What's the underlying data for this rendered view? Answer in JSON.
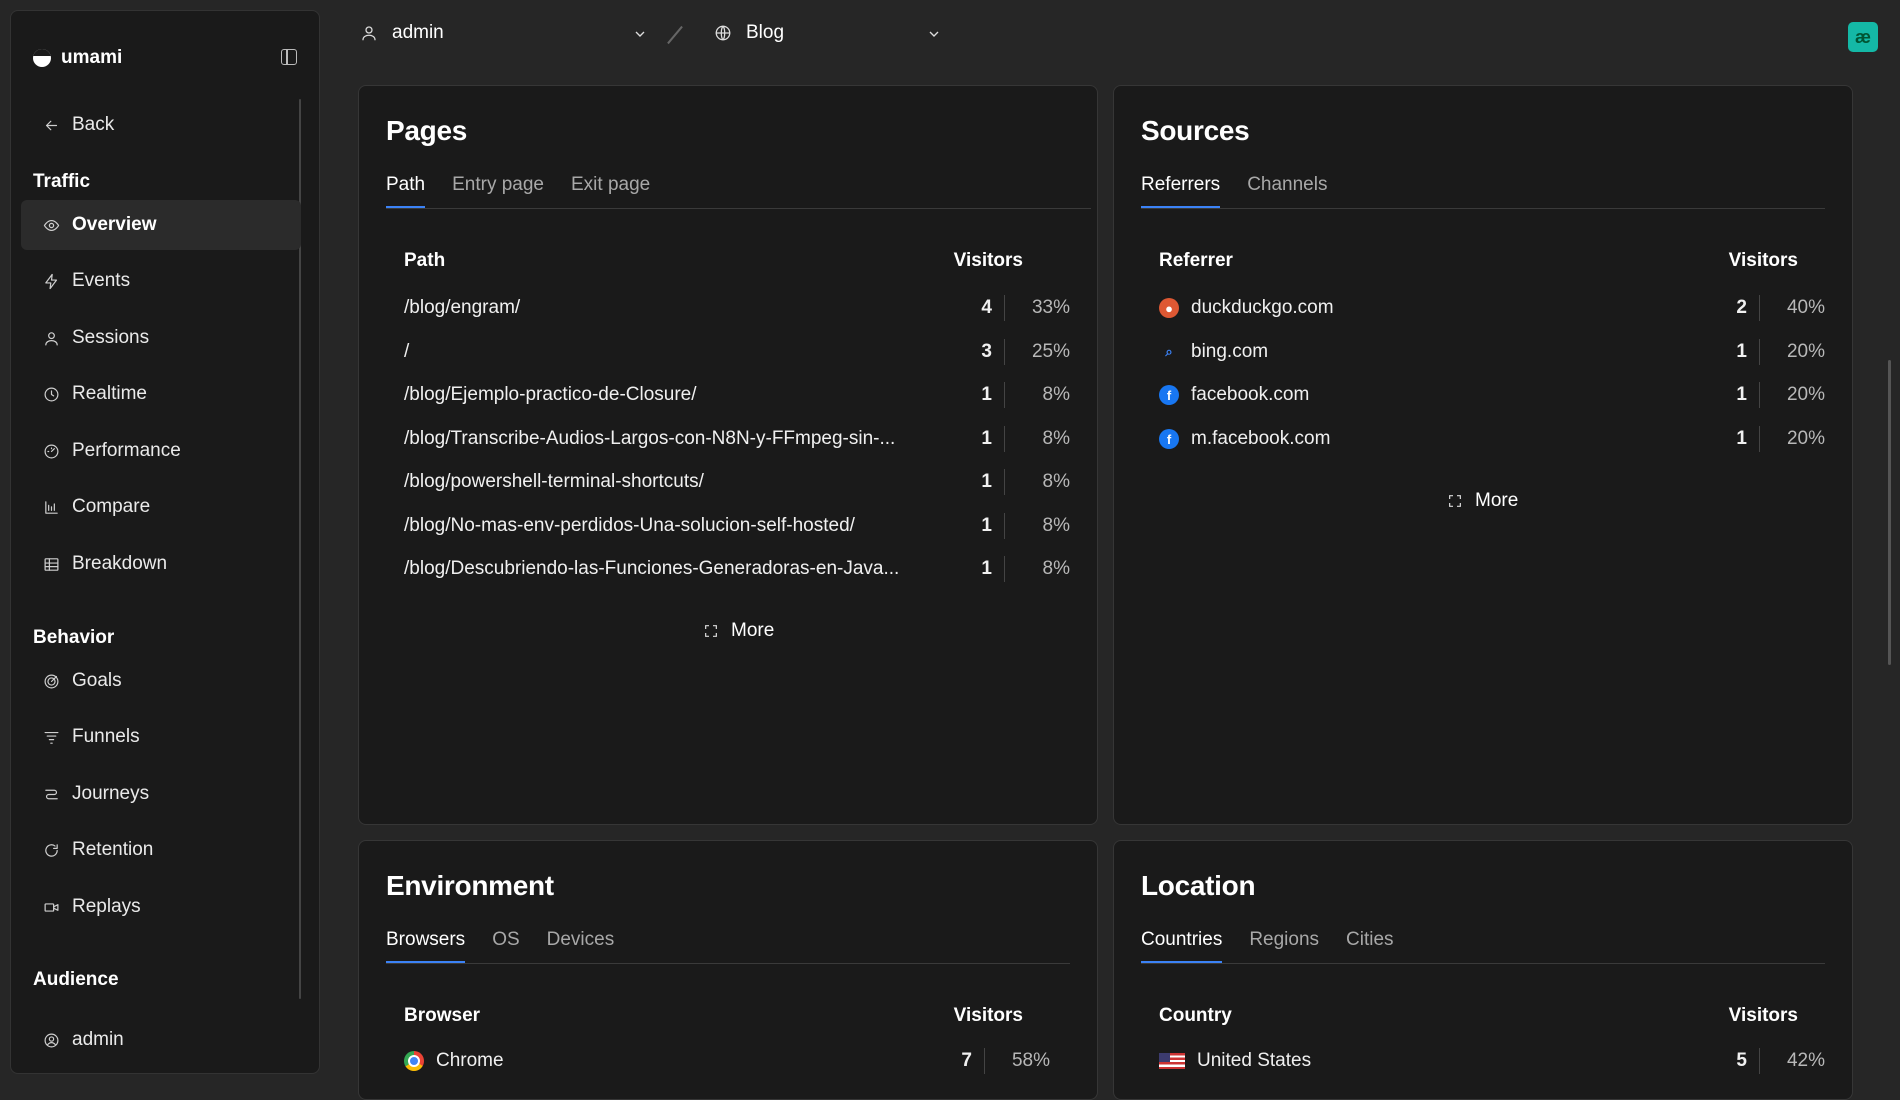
{
  "app": {
    "name": "umami"
  },
  "topbar": {
    "user": "admin",
    "site": "Blog",
    "logo_text": "æ"
  },
  "sidebar": {
    "back": "Back",
    "sections": {
      "traffic": "Traffic",
      "behavior": "Behavior",
      "audience": "Audience"
    },
    "traffic_items": [
      "Overview",
      "Events",
      "Sessions",
      "Realtime",
      "Performance",
      "Compare",
      "Breakdown"
    ],
    "behavior_items": [
      "Goals",
      "Funnels",
      "Journeys",
      "Retention",
      "Replays"
    ],
    "audience_items": [
      "admin"
    ]
  },
  "pages": {
    "title": "Pages",
    "tabs": [
      "Path",
      "Entry page",
      "Exit page"
    ],
    "col_label": "Path",
    "col_value": "Visitors",
    "rows": [
      {
        "label": "/blog/engram/",
        "count": "4",
        "pct": "33%"
      },
      {
        "label": "/",
        "count": "3",
        "pct": "25%"
      },
      {
        "label": "/blog/Ejemplo-practico-de-Closure/",
        "count": "1",
        "pct": "8%"
      },
      {
        "label": "/blog/Transcribe-Audios-Largos-con-N8N-y-FFmpeg-sin-...",
        "count": "1",
        "pct": "8%"
      },
      {
        "label": "/blog/powershell-terminal-shortcuts/",
        "count": "1",
        "pct": "8%"
      },
      {
        "label": "/blog/No-mas-env-perdidos-Una-solucion-self-hosted/",
        "count": "1",
        "pct": "8%"
      },
      {
        "label": "/blog/Descubriendo-las-Funciones-Generadoras-en-Java...",
        "count": "1",
        "pct": "8%"
      }
    ],
    "more": "More"
  },
  "sources": {
    "title": "Sources",
    "tabs": [
      "Referrers",
      "Channels"
    ],
    "col_label": "Referrer",
    "col_value": "Visitors",
    "rows": [
      {
        "label": "duckduckgo.com",
        "count": "2",
        "pct": "40%",
        "icon": "duckduckgo-icon"
      },
      {
        "label": "bing.com",
        "count": "1",
        "pct": "20%",
        "icon": "bing-icon"
      },
      {
        "label": "facebook.com",
        "count": "1",
        "pct": "20%",
        "icon": "facebook-icon"
      },
      {
        "label": "m.facebook.com",
        "count": "1",
        "pct": "20%",
        "icon": "facebook-icon"
      }
    ],
    "more": "More"
  },
  "environment": {
    "title": "Environment",
    "tabs": [
      "Browsers",
      "OS",
      "Devices"
    ],
    "col_label": "Browser",
    "col_value": "Visitors",
    "rows": [
      {
        "label": "Chrome",
        "count": "7",
        "pct": "58%",
        "icon": "chrome-icon"
      }
    ]
  },
  "location": {
    "title": "Location",
    "tabs": [
      "Countries",
      "Regions",
      "Cities"
    ],
    "col_label": "Country",
    "col_value": "Visitors",
    "rows": [
      {
        "label": "United States",
        "count": "5",
        "pct": "42%",
        "icon": "us-flag-icon"
      }
    ]
  },
  "colors": {
    "accent": "#3b82f6",
    "background": "#262626",
    "card": "#1a1a1a",
    "logo": "#14b8a6"
  }
}
